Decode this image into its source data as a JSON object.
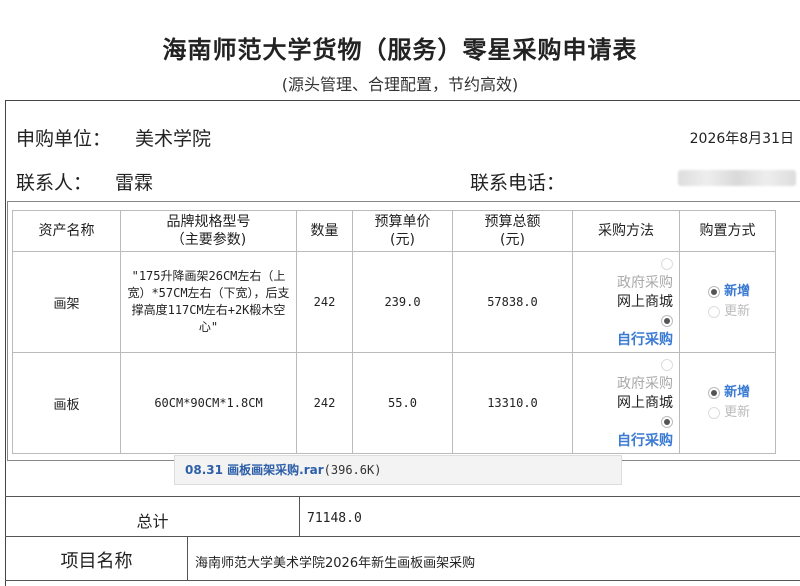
{
  "header": {
    "title": "海南师范大学货物（服务）零星采购申请表",
    "subtitle": "(源头管理、合理配置，节约高效)"
  },
  "info": {
    "unit_label": "申购单位：",
    "unit_value": "美术学院",
    "date": "2026年8月31日",
    "contact_label": "联系人：",
    "contact_value": "雷霖",
    "phone_label": "联系电话："
  },
  "table": {
    "headers": {
      "name": "资产名称",
      "spec_line1": "品牌规格型号",
      "spec_line2": "（主要参数)",
      "qty": "数量",
      "price_line1": "预算单价",
      "price_line2": "(元)",
      "total_line1": "预算总额",
      "total_line2": "(元)",
      "method": "采购方法",
      "buy": "购置方式"
    },
    "rows": [
      {
        "name": "画架",
        "spec": "\"175升降画架26CM左右（上宽）*57CM左右（下宽），后支撑高度117CM左右+2K椴木空心\"",
        "qty": "242",
        "price": "239.0",
        "total": "57838.0"
      },
      {
        "name": "画板",
        "spec": "60CM*90CM*1.8CM",
        "qty": "242",
        "price": "55.0",
        "total": "13310.0"
      }
    ],
    "method_options": {
      "gov": "政府采购",
      "online": "网上商城",
      "self": "自行采购"
    },
    "buy_options": {
      "new": "新增",
      "replace": "更新"
    }
  },
  "attachment": {
    "name": "08.31 画板画架采购.rar",
    "size": "(396.6K)"
  },
  "summary": {
    "total_label": "总计",
    "total_value": "71148.0",
    "project_label": "项目名称",
    "project_value": "海南师范大学美术学院2026年新生画板画架采购"
  }
}
